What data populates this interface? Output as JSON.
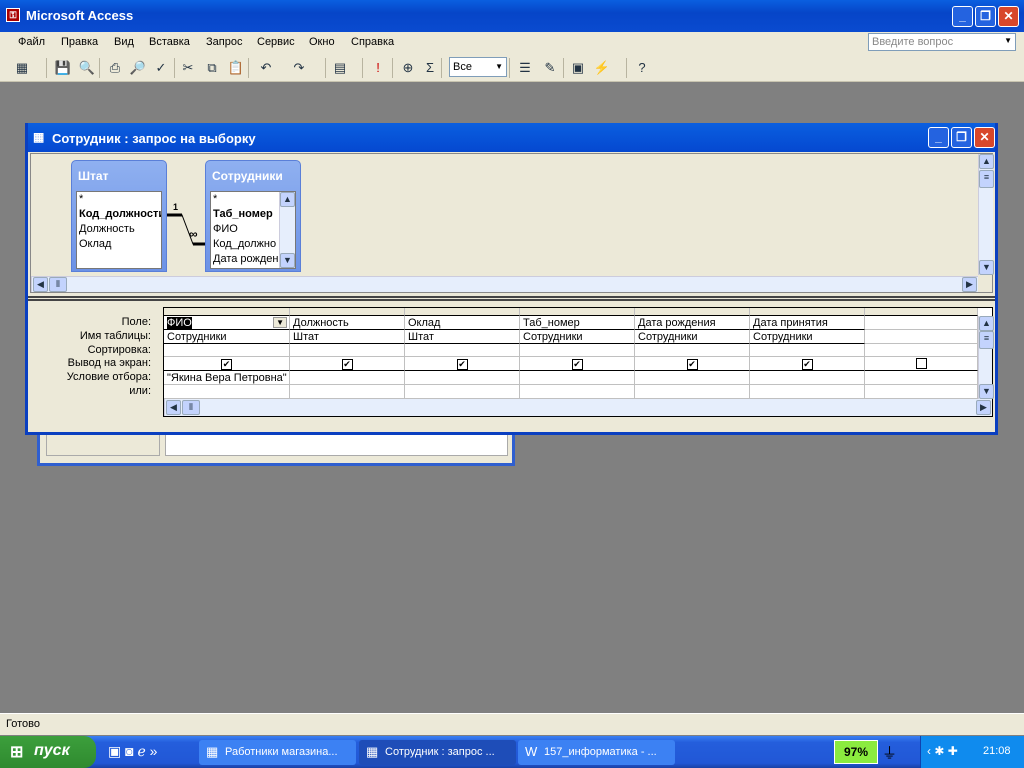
{
  "app": {
    "title": "Microsoft Access",
    "help_placeholder": "Введите вопрос"
  },
  "menu": [
    "Файл",
    "Правка",
    "Вид",
    "Вставка",
    "Запрос",
    "Сервис",
    "Окно",
    "Справка"
  ],
  "toolbar": {
    "top_values": "Все",
    "icons": [
      "view-icon",
      "save-icon",
      "search-icon",
      "print-icon",
      "preview-icon",
      "spelling-icon",
      "cut-icon",
      "copy-icon",
      "paste-icon",
      "undo-icon",
      "redo-icon",
      "query-type-icon",
      "run-icon",
      "show-table-icon",
      "totals-icon",
      "properties-icon",
      "builder-icon",
      "database-window-icon",
      "new-object-icon",
      "help-icon"
    ]
  },
  "query_window": {
    "title": "Сотрудник : запрос на выборку",
    "tables": [
      {
        "name": "Штат",
        "fields": [
          "*",
          "Код_должности",
          "Должность",
          "Оклад"
        ],
        "key": "Код_должности"
      },
      {
        "name": "Сотрудники",
        "fields": [
          "*",
          "Таб_номер",
          "ФИО",
          "Код_должно",
          "Дата рожден"
        ],
        "key": "Таб_номер"
      }
    ],
    "relation": {
      "one": "1",
      "many": "∞"
    },
    "row_labels": [
      "Поле:",
      "Имя таблицы:",
      "Сортировка:",
      "Вывод на экран:",
      "Условие отбора:",
      "или:"
    ],
    "columns": [
      {
        "field": "ФИО",
        "table": "Сотрудники",
        "show": true,
        "criteria": "\"Якина Вера Петровна\""
      },
      {
        "field": "Должность",
        "table": "Штат",
        "show": true,
        "criteria": ""
      },
      {
        "field": "Оклад",
        "table": "Штат",
        "show": true,
        "criteria": ""
      },
      {
        "field": "Таб_номер",
        "table": "Сотрудники",
        "show": true,
        "criteria": ""
      },
      {
        "field": "Дата рождения",
        "table": "Сотрудники",
        "show": true,
        "criteria": ""
      },
      {
        "field": "Дата принятия",
        "table": "Сотрудники",
        "show": true,
        "criteria": ""
      },
      {
        "field": "",
        "table": "",
        "show": false,
        "criteria": ""
      }
    ]
  },
  "status": "Готово",
  "taskbar": {
    "start": "пуск",
    "tasks": [
      "Работники магазина...",
      "Сотрудник : запрос ...",
      "157_информатика - ..."
    ],
    "battery": "97%",
    "clock": "21:08"
  }
}
